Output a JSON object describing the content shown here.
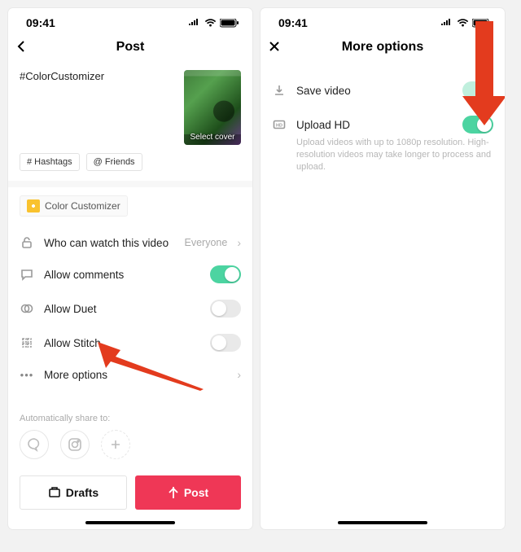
{
  "status": {
    "time": "09:41"
  },
  "post": {
    "title": "Post",
    "caption": "#ColorCustomizer",
    "thumb_label": "Select cover",
    "chips": {
      "hashtags": "# Hashtags",
      "friends": "@ Friends"
    },
    "effect": "Color Customizer",
    "rows": {
      "privacy_label": "Who can watch this video",
      "privacy_value": "Everyone",
      "comments": "Allow comments",
      "duet": "Allow Duet",
      "stitch": "Allow Stitch",
      "more": "More options"
    },
    "share_label": "Automatically share to:",
    "buttons": {
      "drafts": "Drafts",
      "post": "Post"
    }
  },
  "more": {
    "title": "More options",
    "save": "Save video",
    "upload_hd": "Upload HD",
    "upload_hd_sub": "Upload videos with up to 1080p resolution. High-resolution videos may take longer to process and upload."
  }
}
